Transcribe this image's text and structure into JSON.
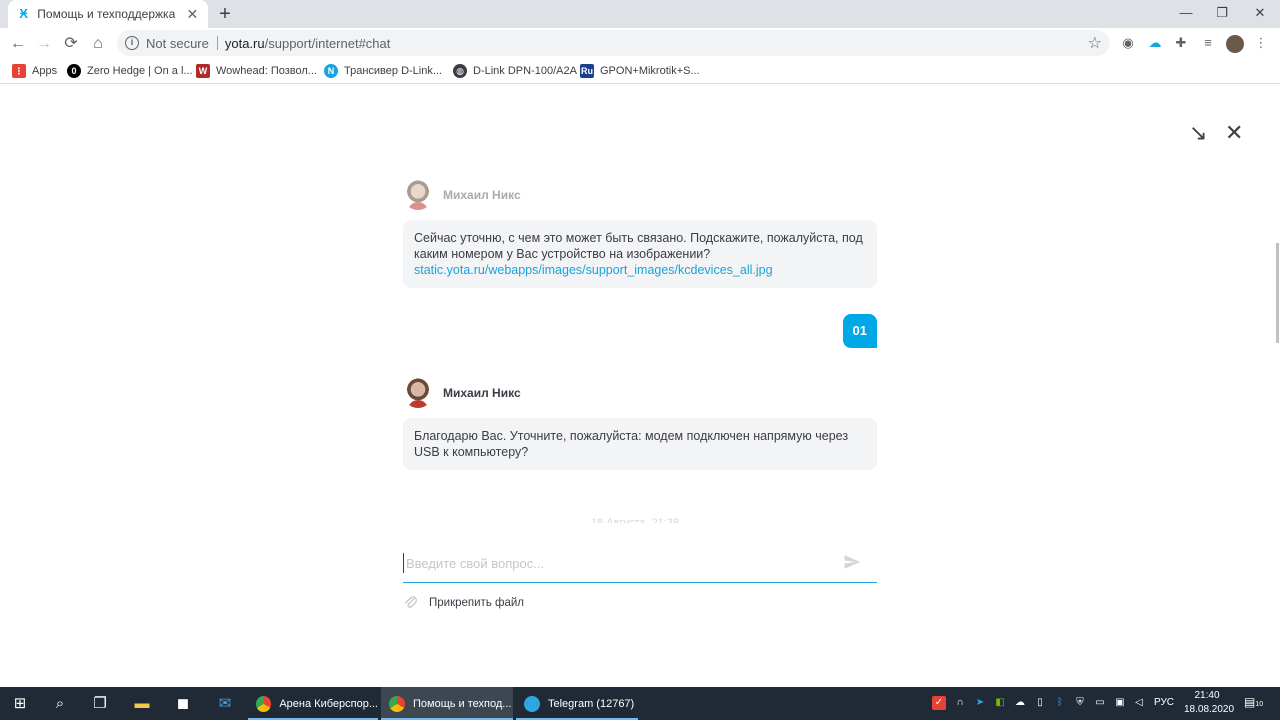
{
  "browser": {
    "tab_title": "Помощь и техподдержка интер",
    "tab_close": "✕",
    "new_tab": "+",
    "minimize": "—",
    "maximize": "❐",
    "close": "✕",
    "not_secure": "Not secure",
    "url_host": "yota.ru",
    "url_path": "/support/internet#chat",
    "bookmarks": [
      {
        "label": "Apps",
        "color": "#e94235"
      },
      {
        "label": "Zero Hedge | On a l...",
        "color": "#000000"
      },
      {
        "label": "Wowhead: Позвол...",
        "color": "#b02a2a"
      },
      {
        "label": "Трансивер D-Link...",
        "color": "#1aa3dc"
      },
      {
        "label": "D-Link DPN-100/A2A",
        "color": "#3c3c46"
      },
      {
        "label": "GPON+Mikrotik+S...",
        "color": "#1c3f94"
      }
    ]
  },
  "chat": {
    "agent_name": "Михаил Никс",
    "messages": [
      {
        "from": "agent",
        "text": "Сейчас уточню, с чем это может быть связано. Подскажите, пожалуйста, под каким номером у Вас устройство на изображении?",
        "link": "static.yota.ru/webapps/images/support_images/kcdevices_all.jpg"
      },
      {
        "from": "user",
        "text": "01"
      },
      {
        "from": "agent",
        "text": "Благодарю Вас. Уточните, пожалуйста: модем подключен напрямую через USB к компьютеру?"
      }
    ],
    "date_fade": "18 Августа, 21:38",
    "input_placeholder": "Введите свой вопрос...",
    "attach_label": "Прикрепить файл"
  },
  "taskbar": {
    "apps": [
      {
        "label": "Арена Киберспор...",
        "color": "#ea4335"
      },
      {
        "label": "Помощь и техпод...",
        "color": "#ea4335"
      },
      {
        "label": "Telegram (12767)",
        "color": "#2ea6df"
      }
    ],
    "lang": "РУС",
    "time": "21:40",
    "date": "18.08.2020",
    "notifications": "10"
  }
}
